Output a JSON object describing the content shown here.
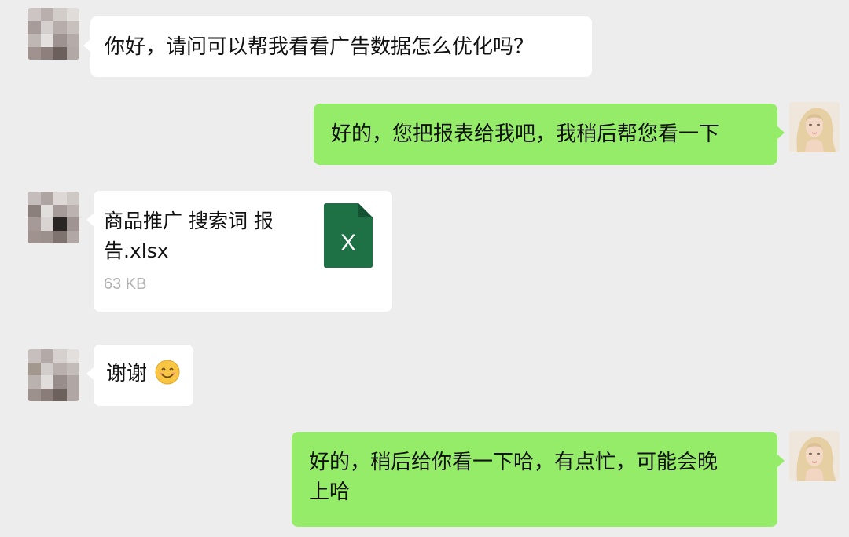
{
  "messages": [
    {
      "sender": "contact",
      "type": "text",
      "text": "你好，请问可以帮我看看广告数据怎么优化吗？"
    },
    {
      "sender": "me",
      "type": "text",
      "text": "好的，您把报表给我吧，我稍后帮您看一下"
    },
    {
      "sender": "contact",
      "type": "file",
      "file_name": "商品推广 搜索词 报告.xlsx",
      "file_size": "63 KB",
      "file_icon": "excel-icon",
      "file_icon_letter": "X"
    },
    {
      "sender": "contact",
      "type": "text",
      "text": "谢谢",
      "emoji": "smile-emoji"
    },
    {
      "sender": "me",
      "type": "text",
      "text_line1": "好的，稍后给你看一下哈，有点忙，可能会晚",
      "text_line2": "上哈"
    }
  ],
  "colors": {
    "background": "#ededed",
    "incoming_bubble": "#ffffff",
    "outgoing_bubble": "#95ec69",
    "excel_green": "#1e7145",
    "file_size_gray": "#b2b2b2"
  }
}
